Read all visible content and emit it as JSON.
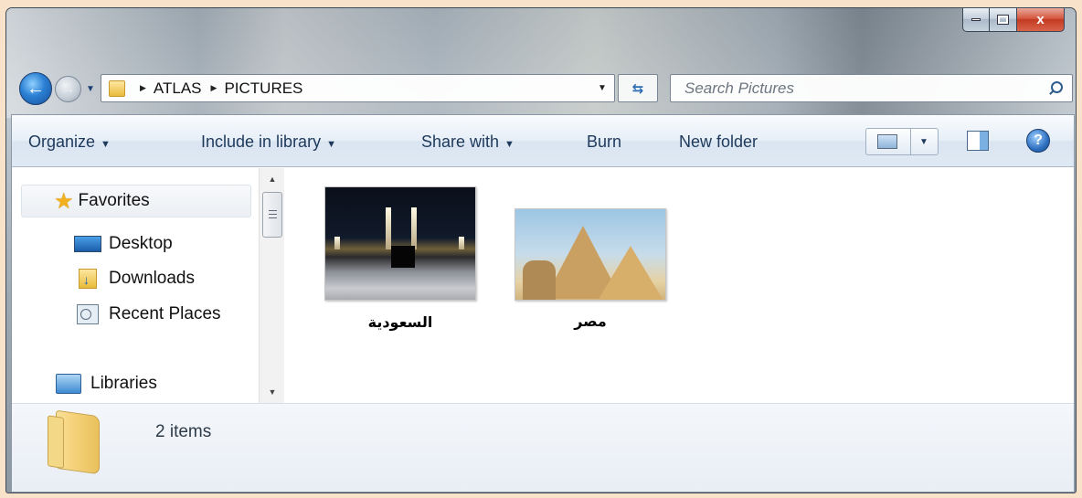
{
  "window": {
    "close_glyph": "x"
  },
  "nav": {
    "back_glyph": "←",
    "forward_glyph": "→",
    "history_glyph": "▼"
  },
  "address": {
    "breadcrumb": [
      "ATLAS",
      "PICTURES"
    ],
    "separator_glyph": "▶",
    "dropdown_glyph": "▼",
    "refresh_glyph": "⇆"
  },
  "search": {
    "placeholder": "Search Pictures"
  },
  "toolbar": {
    "organize": "Organize",
    "include_in_library": "Include in library",
    "share_with": "Share with",
    "burn": "Burn",
    "new_folder": "New folder",
    "dropdown_glyph": "▼",
    "help_glyph": "?"
  },
  "sidebar": {
    "favorites": "Favorites",
    "star_glyph": "★",
    "items": [
      {
        "label": "Desktop",
        "icon": "desktop-icon"
      },
      {
        "label": "Downloads",
        "icon": "downloads-icon"
      },
      {
        "label": "Recent Places",
        "icon": "recent-places-icon"
      }
    ],
    "libraries": "Libraries",
    "scroll_up_glyph": "▲",
    "scroll_down_glyph": "▼"
  },
  "files": [
    {
      "name": "السعودية",
      "thumbnail": "kaaba-mecca-photo"
    },
    {
      "name": "مصر",
      "thumbnail": "pyramids-sphinx-photo"
    }
  ],
  "details": {
    "item_count": "2 items"
  },
  "colors": {
    "toolbar_text": "#1e395b",
    "accent_blue": "#2a7fd3",
    "close_red": "#c23b22"
  }
}
